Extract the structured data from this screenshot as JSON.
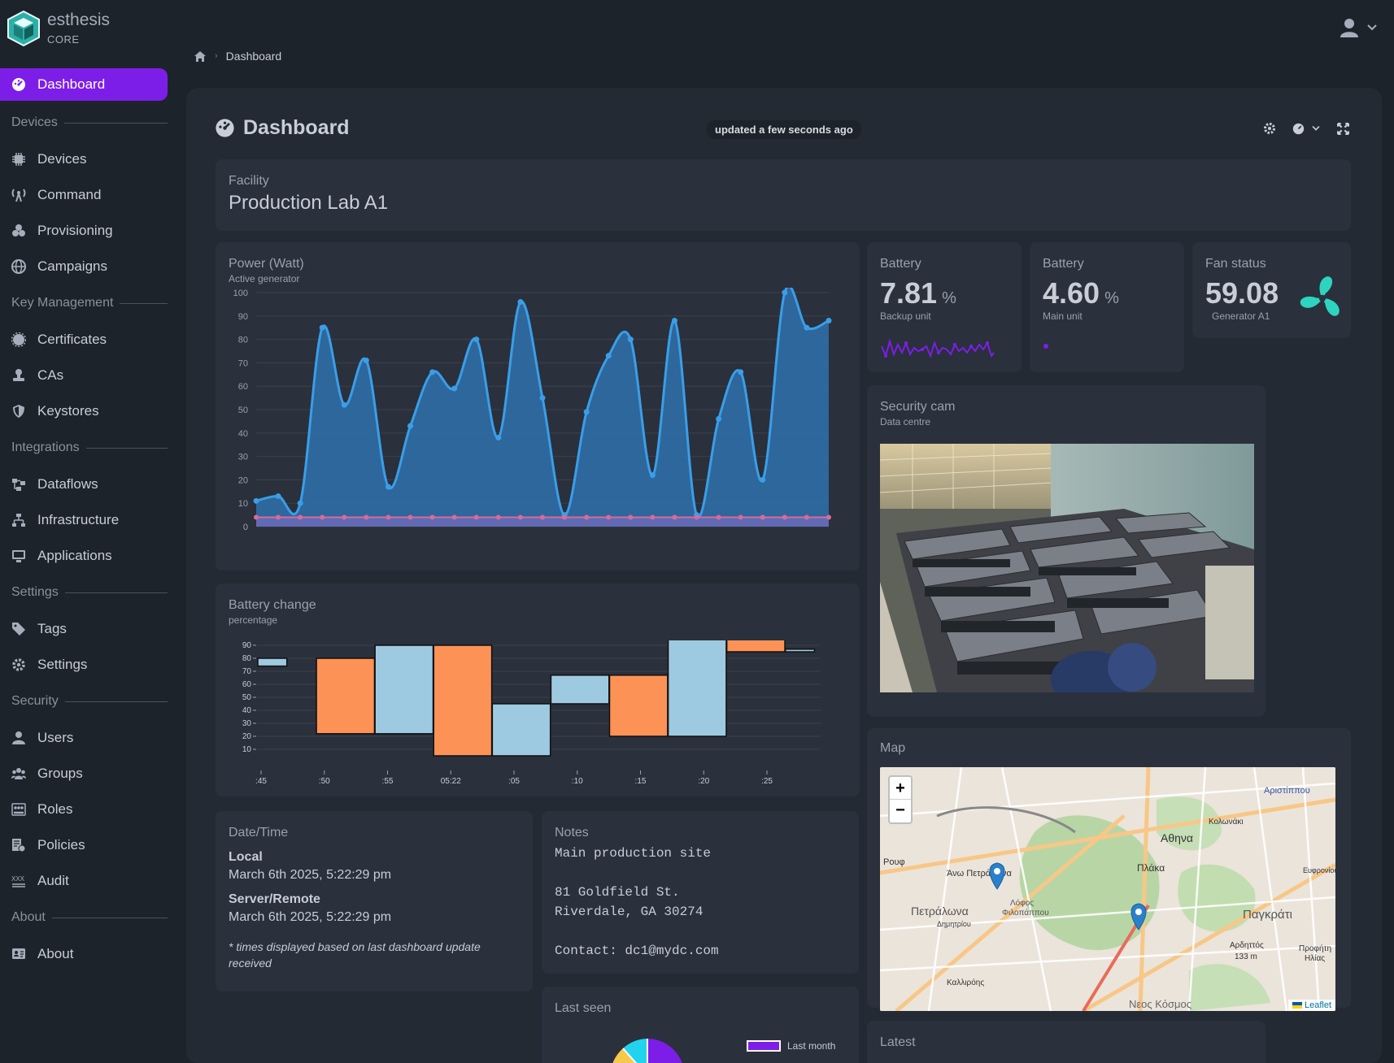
{
  "brand": {
    "name": "esthesis",
    "sub": "CORE"
  },
  "breadcrumb": {
    "current": "Dashboard"
  },
  "sidebar": {
    "active": "Dashboard",
    "sections": [
      {
        "title": "Devices",
        "items": [
          {
            "label": "Devices",
            "icon": "chip-icon"
          },
          {
            "label": "Command",
            "icon": "antenna-icon"
          },
          {
            "label": "Provisioning",
            "icon": "boxes-icon"
          },
          {
            "label": "Campaigns",
            "icon": "globe-icon"
          }
        ]
      },
      {
        "title": "Key Management",
        "items": [
          {
            "label": "Certificates",
            "icon": "certificate-icon"
          },
          {
            "label": "CAs",
            "icon": "stamp-icon"
          },
          {
            "label": "Keystores",
            "icon": "shield-icon"
          }
        ]
      },
      {
        "title": "Integrations",
        "items": [
          {
            "label": "Dataflows",
            "icon": "flow-icon"
          },
          {
            "label": "Infrastructure",
            "icon": "network-icon"
          },
          {
            "label": "Applications",
            "icon": "monitor-icon"
          }
        ]
      },
      {
        "title": "Settings",
        "items": [
          {
            "label": "Tags",
            "icon": "tag-icon"
          },
          {
            "label": "Settings",
            "icon": "gear-icon"
          }
        ]
      },
      {
        "title": "Security",
        "items": [
          {
            "label": "Users",
            "icon": "user-icon"
          },
          {
            "label": "Groups",
            "icon": "users-icon"
          },
          {
            "label": "Roles",
            "icon": "roles-icon"
          },
          {
            "label": "Policies",
            "icon": "policy-icon"
          },
          {
            "label": "Audit",
            "icon": "audit-icon"
          }
        ]
      },
      {
        "title": "About",
        "items": [
          {
            "label": "About",
            "icon": "idcard-icon"
          }
        ]
      }
    ]
  },
  "dashboard": {
    "title": "Dashboard",
    "updated": "updated a few seconds ago"
  },
  "facility": {
    "title": "Facility",
    "value": "Production Lab A1"
  },
  "power": {
    "title": "Power (Watt)",
    "subtitle": "Active generator"
  },
  "battery_change": {
    "title": "Battery change",
    "subtitle": "percentage"
  },
  "battery1": {
    "title": "Battery",
    "value": "7.81",
    "unit": "%",
    "label": "Backup unit"
  },
  "battery2": {
    "title": "Battery",
    "value": "4.60",
    "unit": "%",
    "label": "Main unit"
  },
  "fan": {
    "title": "Fan status",
    "value": "59.08",
    "label": "Generator A1"
  },
  "cam": {
    "title": "Security cam",
    "subtitle": "Data centre"
  },
  "map": {
    "title": "Map",
    "attribution": "Leaflet",
    "zoom_in": "+",
    "zoom_out": "−",
    "labels": [
      "Αθηνα",
      "Πλάκα",
      "Πετράλωνα",
      "Παγκράτι",
      "Άνω Πετράλωνα",
      "Λόφος Φιλοπάππου",
      "Νεος Κόσμος",
      "Αριστίππου",
      "Κολωνάκι",
      "Ρουφ",
      "Αρδηττός",
      "133 m",
      "Ευφρονίου",
      "Προφήτη Ηλίας",
      "Καλλιρόης",
      "Δημητρίου"
    ]
  },
  "datetime": {
    "title": "Date/Time",
    "local_label": "Local",
    "local": "March 6th 2025, 5:22:29 pm",
    "server_label": "Server/Remote",
    "server": "March 6th 2025, 5:22:29 pm",
    "note": "* times displayed based on last dashboard update received"
  },
  "notes": {
    "title": "Notes",
    "text": "Main production site\n\n81 Goldfield St.\nRiverdale, GA 30274\n\nContact: dc1@mydc.com"
  },
  "lastseen": {
    "title": "Last seen",
    "legend": "Last month"
  },
  "latest": {
    "title": "Latest"
  },
  "colors": {
    "accent": "#7c1ee8",
    "area": "#2e86c8",
    "line": "#3a9ee8",
    "orange": "#fd9256",
    "lightblue": "#9ecae1",
    "fan": "#2dd4bf"
  },
  "chart_data": [
    {
      "type": "area",
      "title": "Power (Watt)",
      "subtitle": "Active generator",
      "ylim": [
        0,
        100
      ],
      "yticks": [
        0,
        10,
        20,
        30,
        40,
        50,
        60,
        70,
        80,
        90,
        100
      ],
      "series": [
        {
          "values": [
            11,
            13,
            10,
            85,
            52,
            71,
            17,
            43,
            66,
            59,
            80,
            38,
            96,
            55,
            5,
            49,
            73,
            80,
            22,
            88,
            5,
            46,
            66,
            20,
            100,
            85,
            88
          ]
        },
        {
          "values": [
            4,
            4,
            4,
            4,
            4,
            4,
            4,
            4,
            4,
            4,
            4,
            4,
            4,
            4,
            4,
            4,
            4,
            4,
            4,
            4,
            4,
            4,
            4,
            4,
            4,
            4,
            4
          ]
        }
      ]
    },
    {
      "type": "bar",
      "title": "Battery change",
      "subtitle": "percentage",
      "ylim": [
        5,
        95
      ],
      "yticks": [
        10,
        20,
        30,
        40,
        50,
        60,
        70,
        80,
        90
      ],
      "xticks": [
        ":45",
        ":50",
        ":55",
        "05:22",
        ":05",
        ":10",
        ":15",
        ":20",
        ":25"
      ],
      "bars": [
        {
          "open": 80,
          "close": 74,
          "dir": "down"
        },
        {
          "open": 80,
          "close": 22,
          "dir": "up"
        },
        {
          "open": 22,
          "close": 90,
          "dir": "down"
        },
        {
          "open": 90,
          "close": 5,
          "dir": "up"
        },
        {
          "open": 5,
          "close": 45,
          "dir": "down"
        },
        {
          "open": 45,
          "close": 67,
          "dir": "down"
        },
        {
          "open": 67,
          "close": 20,
          "dir": "up"
        },
        {
          "open": 20,
          "close": 100,
          "dir": "down"
        },
        {
          "open": 100,
          "close": 85,
          "dir": "up"
        },
        {
          "open": 87,
          "close": 85,
          "dir": "down"
        }
      ]
    }
  ]
}
